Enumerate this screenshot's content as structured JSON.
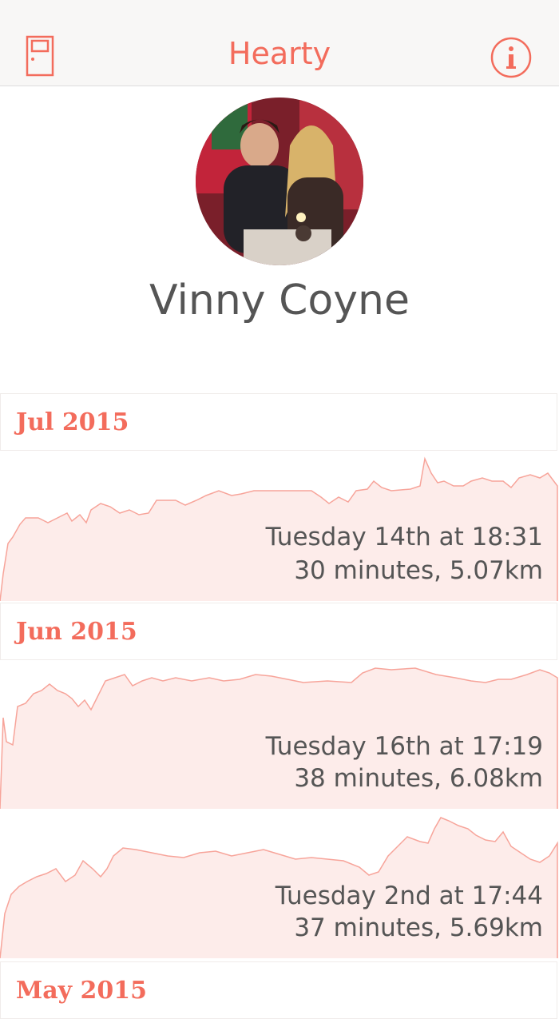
{
  "app": {
    "title": "Hearty"
  },
  "navbar": {
    "left_icon": "door-icon",
    "right_icon": "info-icon"
  },
  "profile": {
    "name": "Vinny Coyne"
  },
  "colors": {
    "accent": "#f36c5c",
    "chart_fill": "#fdecea",
    "chart_stroke": "#f7a49a"
  },
  "sections": [
    {
      "month": "Jul 2015",
      "runs": [
        {
          "date": "Tuesday 14th at 18:31",
          "stats": "30 minutes, 5.07km"
        }
      ]
    },
    {
      "month": "Jun 2015",
      "runs": [
        {
          "date": "Tuesday 16th at 17:19",
          "stats": "38 minutes, 6.08km"
        },
        {
          "date": "Tuesday 2nd at 17:44",
          "stats": "37 minutes, 5.69km"
        }
      ]
    },
    {
      "month": "May 2015",
      "runs": []
    }
  ]
}
